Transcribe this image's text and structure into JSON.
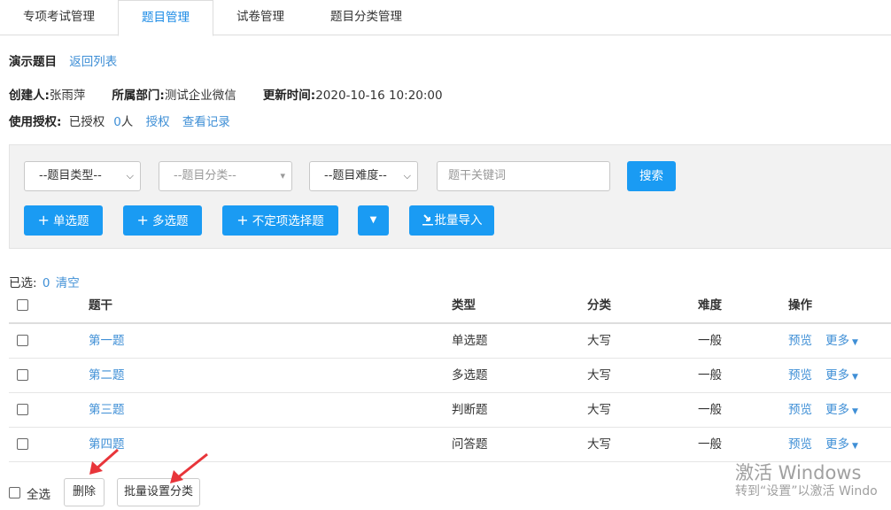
{
  "tabs": [
    {
      "label": "专项考试管理"
    },
    {
      "label": "题目管理"
    },
    {
      "label": "试卷管理"
    },
    {
      "label": "题目分类管理"
    }
  ],
  "title": {
    "name": "演示题目",
    "back_link": "返回列表"
  },
  "meta": {
    "creator_label": "创建人:",
    "creator": "张雨萍",
    "dept_label": "所属部门:",
    "dept": "测试企业微信",
    "updated_label": "更新时间:",
    "updated": "2020-10-16 10:20:00"
  },
  "auth": {
    "label": "使用授权:",
    "authorized_prefix": "已授权",
    "authorized_count": "0",
    "authorized_suffix": "人",
    "grant_link": "授权",
    "log_link": "查看记录"
  },
  "filters": {
    "type_select": "--题目类型--",
    "category_select": "--题目分类--",
    "difficulty_select": "--题目难度--",
    "keyword_placeholder": "题干关键词",
    "search_button": "搜索"
  },
  "actions": {
    "single_choice": "单选题",
    "multi_choice": "多选题",
    "indefinite_choice": "不定项选择题",
    "batch_import": "批量导入"
  },
  "selection": {
    "label": "已选:",
    "count": "0",
    "clear": "清空"
  },
  "table": {
    "headers": [
      "题干",
      "类型",
      "分类",
      "难度",
      "操作"
    ],
    "rows": [
      {
        "stem": "第一题",
        "type": "单选题",
        "category": "大写",
        "difficulty": "一般",
        "preview": "预览",
        "more": "更多"
      },
      {
        "stem": "第二题",
        "type": "多选题",
        "category": "大写",
        "difficulty": "一般",
        "preview": "预览",
        "more": "更多"
      },
      {
        "stem": "第三题",
        "type": "判断题",
        "category": "大写",
        "difficulty": "一般",
        "preview": "预览",
        "more": "更多"
      },
      {
        "stem": "第四题",
        "type": "问答题",
        "category": "大写",
        "difficulty": "一般",
        "preview": "预览",
        "more": "更多"
      }
    ]
  },
  "footer": {
    "select_all": "全选",
    "delete": "删除",
    "batch_category": "批量设置分类"
  },
  "watermark": {
    "line1": "激活 Windows",
    "line2": "转到“设置”以激活 Windo"
  },
  "colors": {
    "accent": "#1a9bf3",
    "link": "#3f8fd6",
    "annotation_arrow": "#e8353a"
  }
}
